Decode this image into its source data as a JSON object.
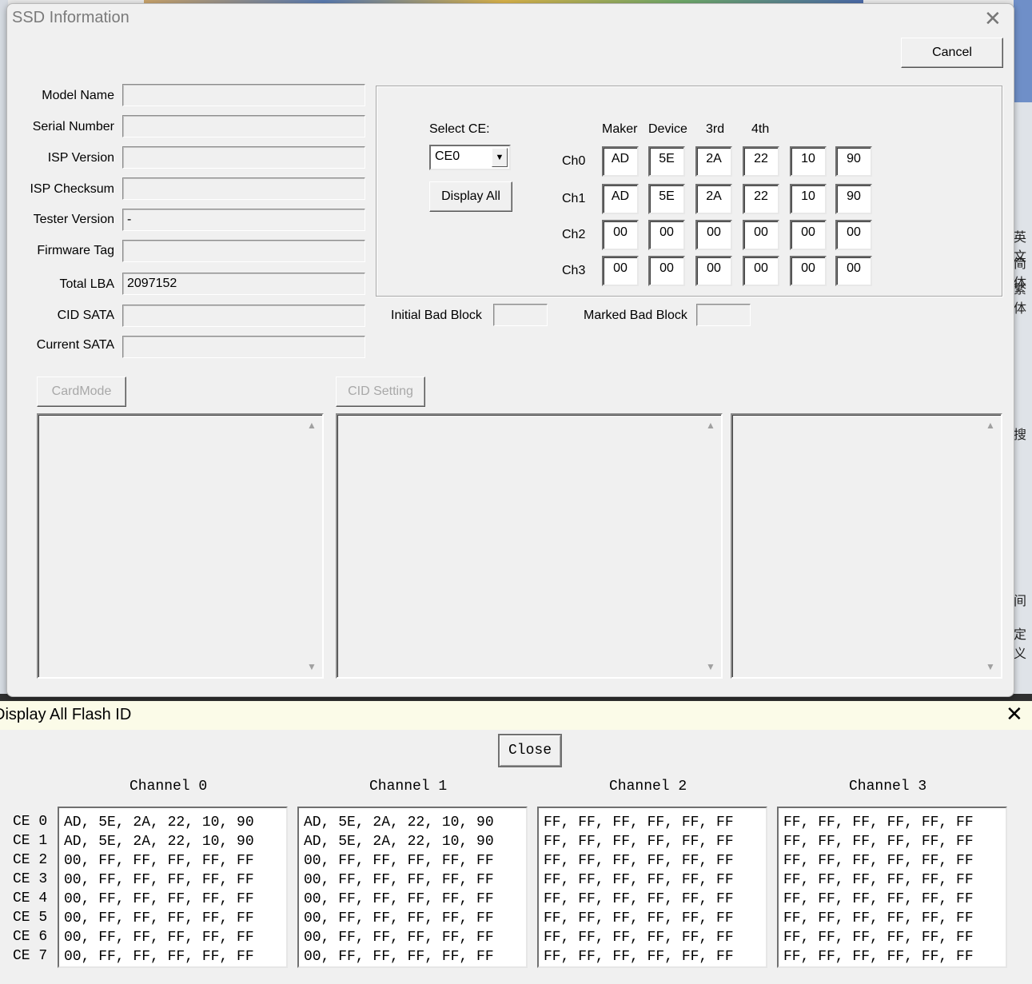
{
  "ssd_window": {
    "title": "SSD Information",
    "cancel_label": "Cancel",
    "fields": [
      {
        "label": "Model Name",
        "value": ""
      },
      {
        "label": "Serial Number",
        "value": ""
      },
      {
        "label": "ISP Version",
        "value": ""
      },
      {
        "label": "ISP Checksum",
        "value": ""
      },
      {
        "label": "Tester Version",
        "value": "-"
      },
      {
        "label": "Firmware Tag",
        "value": ""
      },
      {
        "label": "Total LBA",
        "value": "2097152"
      },
      {
        "label": "CID SATA",
        "value": ""
      },
      {
        "label": "Current SATA",
        "value": ""
      }
    ],
    "select_ce_label": "Select CE:",
    "select_ce_value": "CE0",
    "display_all_label": "Display All",
    "columns": [
      "Maker",
      "Device",
      "3rd",
      "4th"
    ],
    "channels": [
      {
        "label": "Ch0",
        "bytes": [
          "AD",
          "5E",
          "2A",
          "22",
          "10",
          "90"
        ]
      },
      {
        "label": "Ch1",
        "bytes": [
          "AD",
          "5E",
          "2A",
          "22",
          "10",
          "90"
        ]
      },
      {
        "label": "Ch2",
        "bytes": [
          "00",
          "00",
          "00",
          "00",
          "00",
          "00"
        ]
      },
      {
        "label": "Ch3",
        "bytes": [
          "00",
          "00",
          "00",
          "00",
          "00",
          "00"
        ]
      }
    ],
    "initial_bad_block_label": "Initial Bad Block",
    "initial_bad_block_value": "",
    "marked_bad_block_label": "Marked Bad Block",
    "marked_bad_block_value": "",
    "cardmode_label": "CardMode",
    "cid_setting_label": "CID Setting"
  },
  "flash_window": {
    "title": "Display All Flash ID",
    "close_label": "Close",
    "channel_headers": [
      "Channel 0",
      "Channel 1",
      "Channel 2",
      "Channel 3"
    ],
    "ce_labels": [
      "CE 0",
      "CE 1",
      "CE 2",
      "CE 3",
      "CE 4",
      "CE 5",
      "CE 6",
      "CE 7"
    ],
    "channels": [
      [
        "AD, 5E, 2A, 22, 10, 90",
        "AD, 5E, 2A, 22, 10, 90",
        "00, FF, FF, FF, FF, FF",
        "00, FF, FF, FF, FF, FF",
        "00, FF, FF, FF, FF, FF",
        "00, FF, FF, FF, FF, FF",
        "00, FF, FF, FF, FF, FF",
        "00, FF, FF, FF, FF, FF"
      ],
      [
        "AD, 5E, 2A, 22, 10, 90",
        "AD, 5E, 2A, 22, 10, 90",
        "00, FF, FF, FF, FF, FF",
        "00, FF, FF, FF, FF, FF",
        "00, FF, FF, FF, FF, FF",
        "00, FF, FF, FF, FF, FF",
        "00, FF, FF, FF, FF, FF",
        "00, FF, FF, FF, FF, FF"
      ],
      [
        "FF, FF, FF, FF, FF, FF",
        "FF, FF, FF, FF, FF, FF",
        "FF, FF, FF, FF, FF, FF",
        "FF, FF, FF, FF, FF, FF",
        "FF, FF, FF, FF, FF, FF",
        "FF, FF, FF, FF, FF, FF",
        "FF, FF, FF, FF, FF, FF",
        "FF, FF, FF, FF, FF, FF"
      ],
      [
        "FF, FF, FF, FF, FF, FF",
        "FF, FF, FF, FF, FF, FF",
        "FF, FF, FF, FF, FF, FF",
        "FF, FF, FF, FF, FF, FF",
        "FF, FF, FF, FF, FF, FF",
        "FF, FF, FF, FF, FF, FF",
        "FF, FF, FF, FF, FF, FF",
        "FF, FF, FF, FF, FF, FF"
      ]
    ]
  },
  "background_glyphs": [
    "英文",
    "简体",
    "繁体",
    "搜",
    "间",
    "定义"
  ]
}
